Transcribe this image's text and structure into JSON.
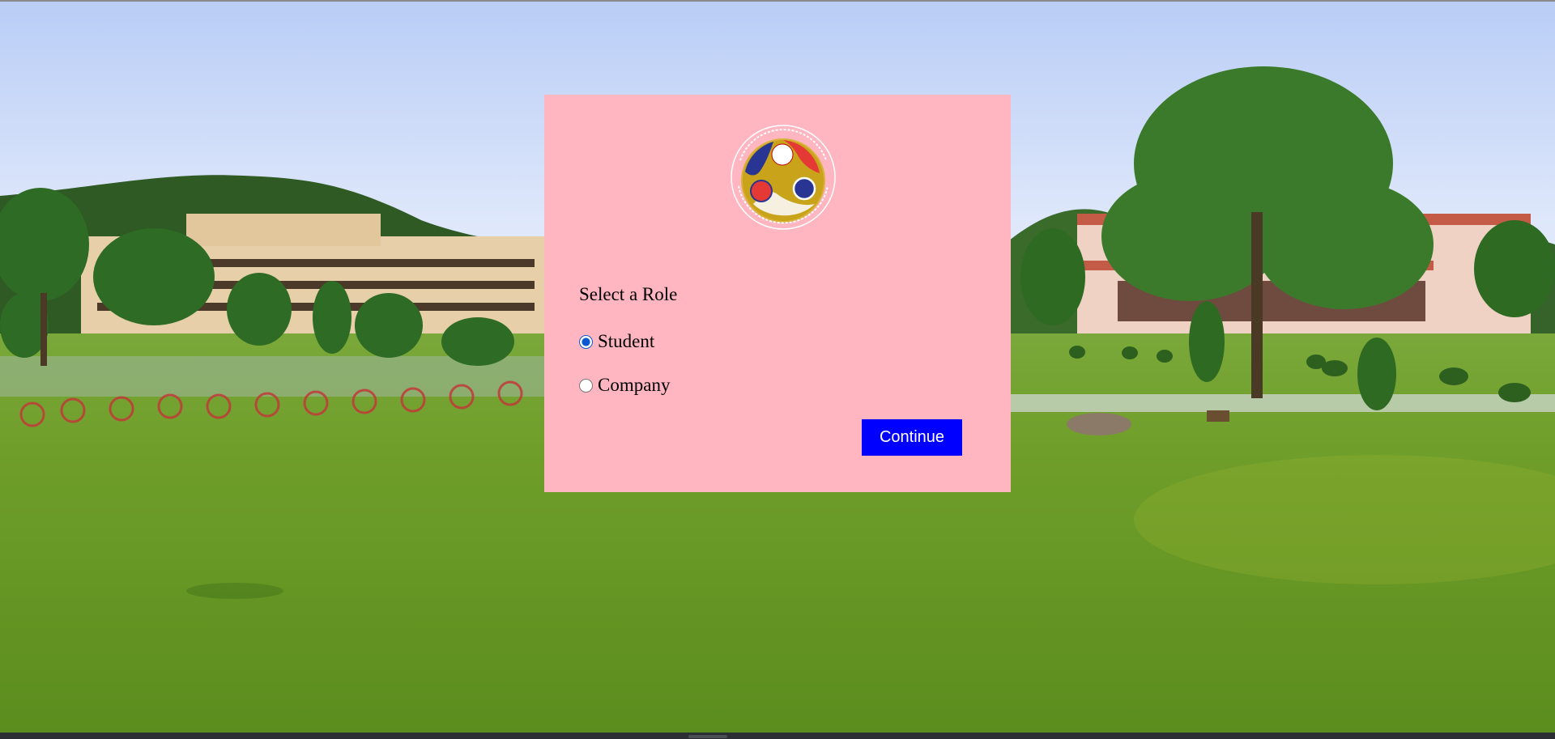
{
  "card": {
    "heading": "Select a Role",
    "logo_alt": "Indian Institute of Technology Guwahati",
    "roles": [
      {
        "label": "Student",
        "value": "student",
        "checked": true
      },
      {
        "label": "Company",
        "value": "company",
        "checked": false
      }
    ],
    "continue_label": "Continue"
  },
  "colors": {
    "card_background": "#ffb6c1",
    "button_background": "#0000ff",
    "button_text": "#ffffff",
    "radio_accent": "#0b57d0"
  },
  "icons": {
    "logo": "iit-guwahati-emblem"
  }
}
